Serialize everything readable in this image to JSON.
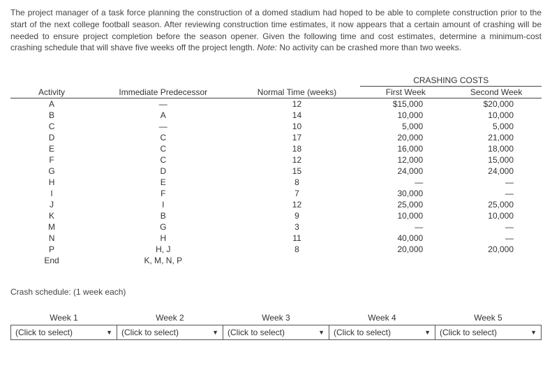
{
  "problem": {
    "text": "The project manager of a task force planning the construction of a domed stadium had hoped to be able to complete construction prior to the start of the next college football season. After reviewing construction time estimates, it now appears that a certain amount of crashing will be needed to ensure project completion before the season opener. Given the following time and cost estimates, determine a minimum-cost crashing schedule that will shave five weeks off the project length. ",
    "note_label": "Note:",
    "note_text": " No activity can be crashed more than two weeks."
  },
  "table": {
    "headers": {
      "activity": "Activity",
      "predecessor": "Immediate Predecessor",
      "normal_time": "Normal Time (weeks)",
      "crashing_group": "CRASHING COSTS",
      "first_week": "First Week",
      "second_week": "Second Week"
    },
    "rows": [
      {
        "activity": "A",
        "pred": "—",
        "time": "12",
        "c1": "$15,000",
        "c2": "$20,000"
      },
      {
        "activity": "B",
        "pred": "A",
        "time": "14",
        "c1": "10,000",
        "c2": "10,000"
      },
      {
        "activity": "C",
        "pred": "—",
        "time": "10",
        "c1": "5,000",
        "c2": "5,000"
      },
      {
        "activity": "D",
        "pred": "C",
        "time": "17",
        "c1": "20,000",
        "c2": "21,000"
      },
      {
        "activity": "E",
        "pred": "C",
        "time": "18",
        "c1": "16,000",
        "c2": "18,000"
      },
      {
        "activity": "F",
        "pred": "C",
        "time": "12",
        "c1": "12,000",
        "c2": "15,000"
      },
      {
        "activity": "G",
        "pred": "D",
        "time": "15",
        "c1": "24,000",
        "c2": "24,000"
      },
      {
        "activity": "H",
        "pred": "E",
        "time": "8",
        "c1": "—",
        "c2": "—"
      },
      {
        "activity": "I",
        "pred": "F",
        "time": "7",
        "c1": "30,000",
        "c2": "—"
      },
      {
        "activity": "J",
        "pred": "I",
        "time": "12",
        "c1": "25,000",
        "c2": "25,000"
      },
      {
        "activity": "K",
        "pred": "B",
        "time": "9",
        "c1": "10,000",
        "c2": "10,000"
      },
      {
        "activity": "M",
        "pred": "G",
        "time": "3",
        "c1": "—",
        "c2": "—"
      },
      {
        "activity": "N",
        "pred": "H",
        "time": "11",
        "c1": "40,000",
        "c2": "—"
      },
      {
        "activity": "P",
        "pred": "H, J",
        "time": "8",
        "c1": "20,000",
        "c2": "20,000"
      },
      {
        "activity": "End",
        "pred": "K, M, N, P",
        "time": "",
        "c1": "",
        "c2": ""
      }
    ]
  },
  "answer_section": {
    "label": "Crash schedule: (1 week each)",
    "placeholder": "(Click to select)",
    "columns": [
      "Week 1",
      "Week 2",
      "Week 3",
      "Week 4",
      "Week 5"
    ]
  }
}
